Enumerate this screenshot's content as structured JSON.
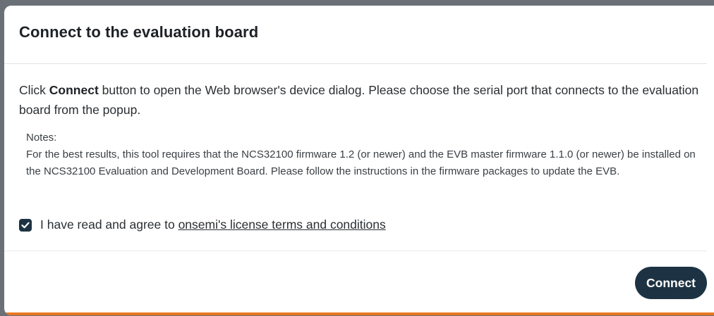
{
  "dialog": {
    "title": "Connect to the evaluation board",
    "intro_prefix": "Click ",
    "intro_bold": "Connect",
    "intro_suffix": " button to open the Web browser's device dialog. Please choose the serial port that connects to the evaluation board from the popup.",
    "notes_heading": "Notes:",
    "notes_text": "For the best results, this tool requires that the NCS32100 firmware 1.2 (or newer) and the EVB master firmware 1.1.0 (or newer) be installed on the NCS32100 Evaluation and Development Board. Please follow the instructions in the firmware packages to update the EVB.",
    "agree_label": "I have read and agree to ",
    "license_link": "onsemi's license terms and conditions",
    "agree_checked": true,
    "connect_label": "Connect"
  },
  "icons": {
    "checkbox": "check-icon"
  },
  "colors": {
    "primary": "#1d3343",
    "accent": "#e87722",
    "text": "#2b2f33"
  }
}
